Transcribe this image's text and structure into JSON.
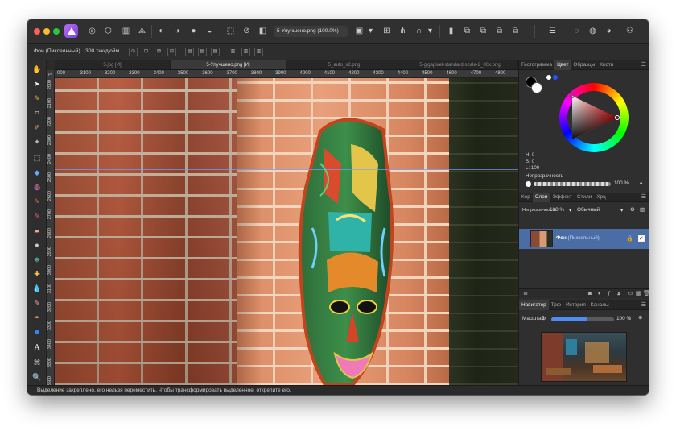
{
  "toolbar": {
    "document_title": "5-Улучшено.png (100.0%)"
  },
  "context": {
    "layer_label": "Фон (Пиксельный)",
    "dpi_label": "300 тчк/дюйм"
  },
  "doc_tabs": [
    {
      "label": "5.jpg [И]"
    },
    {
      "label": "5-Улучшено.png [И]"
    },
    {
      "label": "5_auto_x2.png"
    },
    {
      "label": "5-gigapixel-standard-scale-2_00x.png"
    }
  ],
  "rulers": {
    "unit": "px",
    "top_labels": [
      "000",
      "3100",
      "3200",
      "3300",
      "3400",
      "3500",
      "3600",
      "3700",
      "3800",
      "3900",
      "4000",
      "4100",
      "4200",
      "4300",
      "4400",
      "4500",
      "4600",
      "4700",
      "4800"
    ],
    "left_labels": [
      "2000",
      "2100",
      "2200",
      "2300",
      "2400",
      "2500",
      "2600",
      "2700",
      "2800",
      "2900",
      "3000",
      "3100",
      "3200",
      "3300",
      "3400",
      "3500",
      "3600"
    ]
  },
  "panel_color": {
    "tabs": [
      "Гистограмма",
      "Цвет",
      "Образцы",
      "Кисти"
    ],
    "active_tab": "Цвет",
    "h": "H: 0",
    "s": "S: 0",
    "l": "L: 100",
    "opacity_label": "Непрозрачность",
    "opacity_value": "100 %",
    "accent_color": "#ff2b2b"
  },
  "panel_layers": {
    "tabs": [
      "Кор",
      "Слои",
      "Эффект",
      "Стили",
      "Хрц"
    ],
    "active_tab": "Слои",
    "opacity_label": "Непрозрачность",
    "opacity_value": "100 %",
    "blend_mode": "Обычный",
    "layer_name": "Фон",
    "layer_type": "(Пиксельный)",
    "selection_color": "#4a6da6"
  },
  "panel_navigator": {
    "tabs": [
      "Навигатор",
      "Трф",
      "История",
      "Каналы"
    ],
    "active_tab": "Навигатор",
    "zoom_label": "Масштаб",
    "zoom_value": "100 %",
    "zoom_percent": 100
  },
  "status": {
    "message": "Выделение закреплено, его нельзя переместить. Чтобы трансформировать выделенное, открепите его."
  }
}
